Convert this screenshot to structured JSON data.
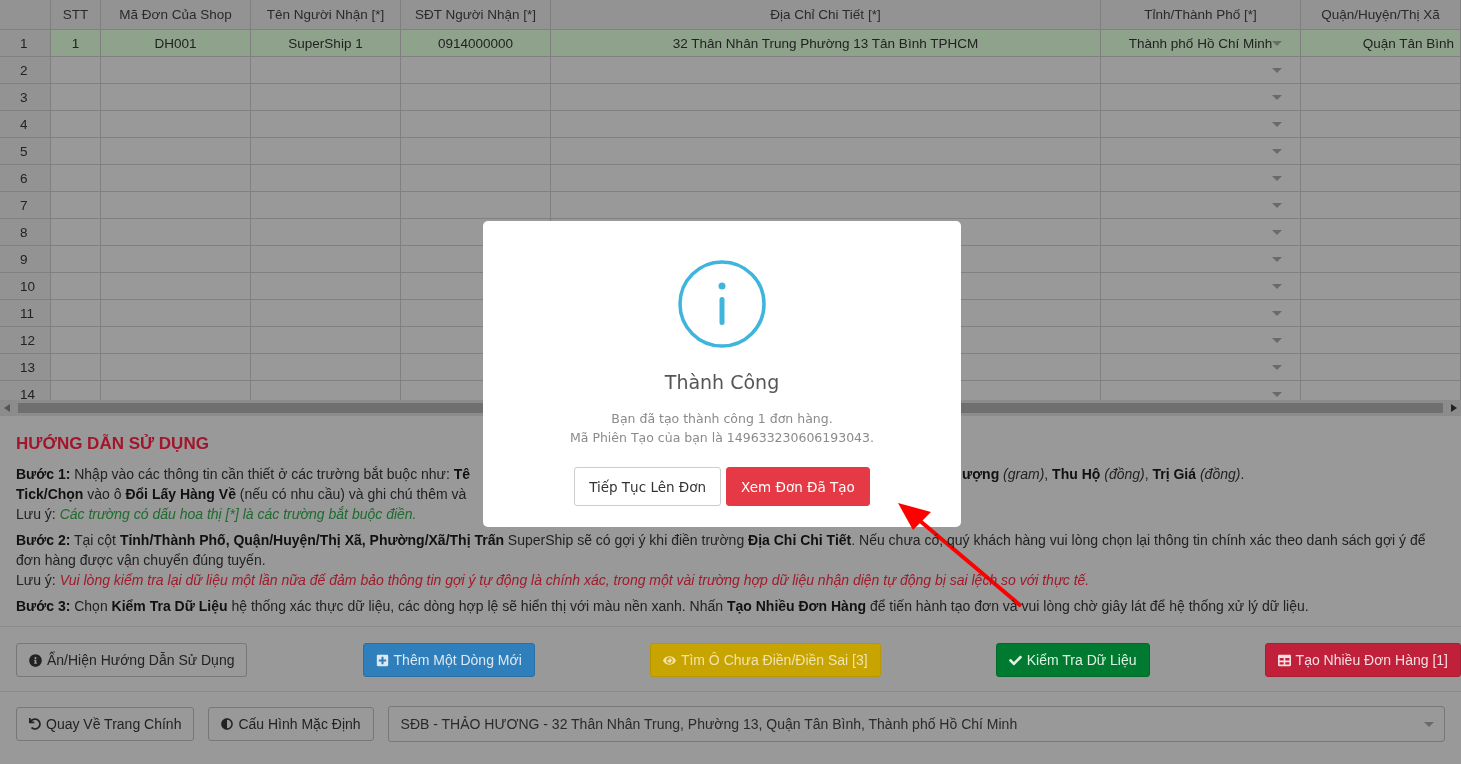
{
  "table": {
    "columns": [
      "STT",
      "Mã Đơn Của Shop",
      "Tên Người Nhận [*]",
      "SĐT Người Nhận [*]",
      "Địa Chỉ Chi Tiết [*]",
      "Tỉnh/Thành Phố [*]",
      "Quận/Huyện/Thị Xã"
    ],
    "rows": [
      {
        "number": "1",
        "valid": true,
        "cells": [
          "1",
          "DH001",
          "SuperShip 1",
          "0914000000",
          "32 Thân Nhân Trung Phường 13 Tân Bình TPHCM",
          "Thành phố Hồ Chí Minh",
          "Quận Tân Bình"
        ]
      },
      {
        "number": "2",
        "valid": false
      },
      {
        "number": "3",
        "valid": false
      },
      {
        "number": "4",
        "valid": false
      },
      {
        "number": "5",
        "valid": false
      },
      {
        "number": "6",
        "valid": false
      },
      {
        "number": "7",
        "valid": false
      },
      {
        "number": "8",
        "valid": false
      },
      {
        "number": "9",
        "valid": false
      },
      {
        "number": "10",
        "valid": false
      },
      {
        "number": "11",
        "valid": false
      },
      {
        "number": "12",
        "valid": false
      },
      {
        "number": "13",
        "valid": false
      },
      {
        "number": "14",
        "valid": false
      }
    ]
  },
  "guide": {
    "title": "HƯỚNG DẪN SỬ DỤNG",
    "sections": [
      {
        "lines": [
          {
            "kind": "split",
            "left": "**Bước 1:** Nhập vào các thông tin cần thiết ở các trường bắt buộc như: **Tê**",
            "right": "**ượng** *(gram)*, **Thu Hộ** *(đồng)*, **Trị Giá** *(đồng)*."
          },
          {
            "kind": "text",
            "text": "**Tick/Chọn** vào ô **Đổi Lấy Hàng Về** (nếu có nhu cầu) và ghi chú thêm và"
          },
          {
            "kind": "note",
            "label": "Lưu ý:",
            "text": "Các trường có dấu hoa thị [*] là các trường bắt buộc điền.",
            "color": "#1e6b2e"
          }
        ]
      },
      {
        "lines": [
          {
            "kind": "text",
            "text": "**Bước 2:** Tại cột **Tỉnh/Thành Phố, Quận/Huyện/Thị Xã, Phường/Xã/Thị Trấn** SuperShip sẽ có gợi ý khi điền trường **Địa Chỉ Chi Tiết**. Nếu chưa có, quý khách hàng vui lòng chọn lại thông tin chính xác theo danh sách gợi ý để đơn hàng được vận chuyển đúng tuyến."
          },
          {
            "kind": "note",
            "label": "Lưu ý:",
            "text": "Vui lòng kiểm tra lại dữ liệu một lần nữa để đảm bảo thông tin gợi ý tự động là chính xác, trong một vài trường hợp dữ liệu nhận diện tự động bị sai lệch so với thực tế.",
            "color": "#a01a2a"
          }
        ]
      },
      {
        "lines": [
          {
            "kind": "text",
            "text": "**Bước 3:** Chọn **Kiểm Tra Dữ Liệu** hệ thống xác thực dữ liệu, các dòng hợp lệ sẽ hiển thị với màu nền xanh. Nhấn **Tạo Nhiều Đơn Hàng** để tiến hành tạo đơn và vui lòng chờ giây lát để hệ thống xử lý dữ liệu."
          }
        ]
      }
    ]
  },
  "actions": [
    {
      "label": "Ẩn/Hiện Hướng Dẫn Sử Dụng",
      "kind": "default"
    },
    {
      "label": "Thêm Một Dòng Mới",
      "kind": "primary"
    },
    {
      "label": "Tìm Ô Chưa Điền/Điền Sai [3]",
      "kind": "warning"
    },
    {
      "label": "Kiểm Tra Dữ Liệu",
      "kind": "success"
    },
    {
      "label": "Tạo Nhiều Đơn Hàng [1]",
      "kind": "danger"
    }
  ],
  "footer": {
    "buttons": [
      "Quay Về Trang Chính",
      "Cấu Hình Mặc Định"
    ],
    "address_select": {
      "value": "SĐB - THẢO HƯƠNG - 32 Thân Nhân Trung, Phường 13, Quận Tân Bình, Thành phố Hồ Chí Minh"
    }
  },
  "dialog": {
    "title": "Thành Công",
    "messages": [
      "Bạn đã tạo thành công 1 đơn hàng.",
      "Mã Phiên Tạo của bạn là 149633230606193043."
    ],
    "buttons": [
      {
        "label": "Tiếp Tục Lên Đơn",
        "kind": "secondary"
      },
      {
        "label": "Xem Đơn Đã Tạo",
        "kind": "confirm"
      }
    ]
  }
}
